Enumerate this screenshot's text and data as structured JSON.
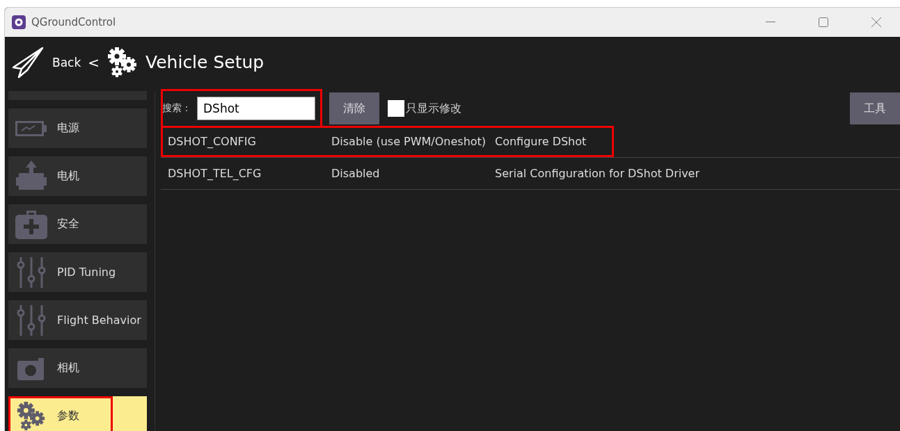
{
  "window": {
    "title": "QGroundControl"
  },
  "header": {
    "back": "Back",
    "separator": "<",
    "title": "Vehicle Setup"
  },
  "sidebar": {
    "items": [
      {
        "kind": "cut",
        "selected": false
      },
      {
        "label": "电源",
        "kind": "battery",
        "selected": false,
        "highlighted": false
      },
      {
        "label": "电机",
        "kind": "motor",
        "selected": false,
        "highlighted": false
      },
      {
        "label": "安全",
        "kind": "safety",
        "selected": false,
        "highlighted": false
      },
      {
        "label": "PID Tuning",
        "kind": "sliders",
        "selected": false,
        "highlighted": false
      },
      {
        "label": "Flight Behavior",
        "kind": "sliders",
        "selected": false,
        "highlighted": false
      },
      {
        "label": "相机",
        "kind": "camera",
        "selected": false,
        "highlighted": false
      },
      {
        "label": "参数",
        "kind": "gears",
        "selected": true,
        "highlighted": true
      }
    ]
  },
  "search": {
    "label": "搜索：",
    "value": "DShot",
    "highlighted": true
  },
  "clear_button": "清除",
  "modified_only": {
    "label": "只显示修改",
    "checked": false
  },
  "tools_button": "工具",
  "table": {
    "rows": [
      {
        "name": "DSHOT_CONFIG",
        "value": "Disable (use PWM/Oneshot)",
        "description": "Configure DShot",
        "highlighted": true
      },
      {
        "name": "DSHOT_TEL_CFG",
        "value": "Disabled",
        "description": "Serial Configuration for DShot Driver",
        "highlighted": false
      }
    ]
  }
}
